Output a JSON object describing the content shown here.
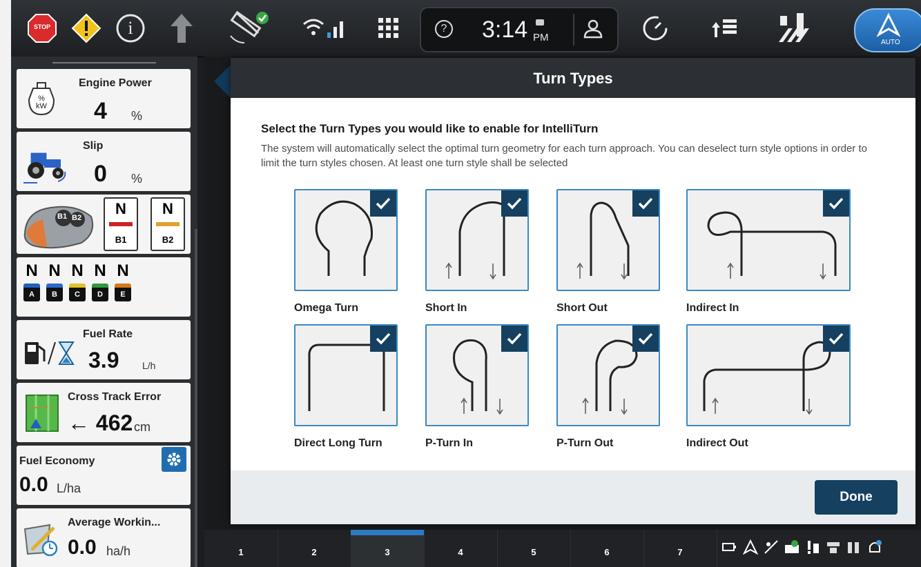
{
  "topbar": {
    "icons": [
      "stop-icon",
      "warning-icon",
      "info-icon",
      "arrow-up-icon",
      "satellite-icon",
      "wifi-signal-icon",
      "grid-menu-icon",
      "speedometer-icon",
      "row-swap-icon",
      "implement-icon"
    ],
    "stop_label": "STOP",
    "info_label": "i",
    "help_label": "?",
    "time": "3:14",
    "ampm": "PM",
    "auto_label": "AUTO"
  },
  "sidebar": {
    "engine_power": {
      "title": "Engine Power",
      "value": "4",
      "unit": "%",
      "icon_text": "%\nkW"
    },
    "slip": {
      "title": "Slip",
      "value": "0",
      "unit": "%"
    },
    "remotes": {
      "b1_state": "N",
      "b2_state": "N",
      "b1_label": "B1",
      "b2_label": "B2"
    },
    "valves": {
      "states": [
        "N",
        "N",
        "N",
        "N",
        "N"
      ],
      "labels": [
        "A",
        "B",
        "C",
        "D",
        "E"
      ],
      "colors": [
        "#2060c0",
        "#2b6ad0",
        "#e2c12c",
        "#2f9a3a",
        "#d47a1c"
      ]
    },
    "fuel_rate": {
      "title": "Fuel Rate",
      "value": "3.9",
      "unit": "L/h"
    },
    "cross_track": {
      "title": "Cross Track Error",
      "value": "← 462",
      "unit": "cm"
    },
    "fuel_economy": {
      "title": "Fuel Economy",
      "value": "0.0",
      "unit": "L/ha"
    },
    "avg_working": {
      "title": "Average Workin...",
      "value": "0.0",
      "unit": "ha/h"
    }
  },
  "modal": {
    "title": "Turn Types",
    "heading": "Select the Turn Types you would like to enable for IntelliTurn",
    "description": "The system will automatically select the optimal turn geometry for each turn approach. You can deselect turn style options in order to limit the turn styles chosen. At least one turn style shall be selected",
    "turn_types": [
      {
        "label": "Omega Turn",
        "checked": true
      },
      {
        "label": "Short In",
        "checked": true
      },
      {
        "label": "Short Out",
        "checked": true
      },
      {
        "label": "Indirect In",
        "checked": true
      },
      {
        "label": "Direct Long Turn",
        "checked": true
      },
      {
        "label": "P-Turn In",
        "checked": true
      },
      {
        "label": "P-Turn Out",
        "checked": true
      },
      {
        "label": "Indirect Out",
        "checked": true
      }
    ],
    "done_label": "Done"
  },
  "bottom_tabs": {
    "labels": [
      "1",
      "2",
      "3",
      "4",
      "5",
      "6",
      "7"
    ],
    "active": "3"
  },
  "status_icons": [
    "battery-usb-icon",
    "guidance-icon",
    "no-signal-icon",
    "isobus-icon",
    "alert-icon",
    "implement-status-icon",
    "section-status-icon",
    "notification-icon"
  ],
  "colors": {
    "accent": "#15405f",
    "tile_border": "#3a8ac0",
    "auto": "#1c5fa6"
  }
}
